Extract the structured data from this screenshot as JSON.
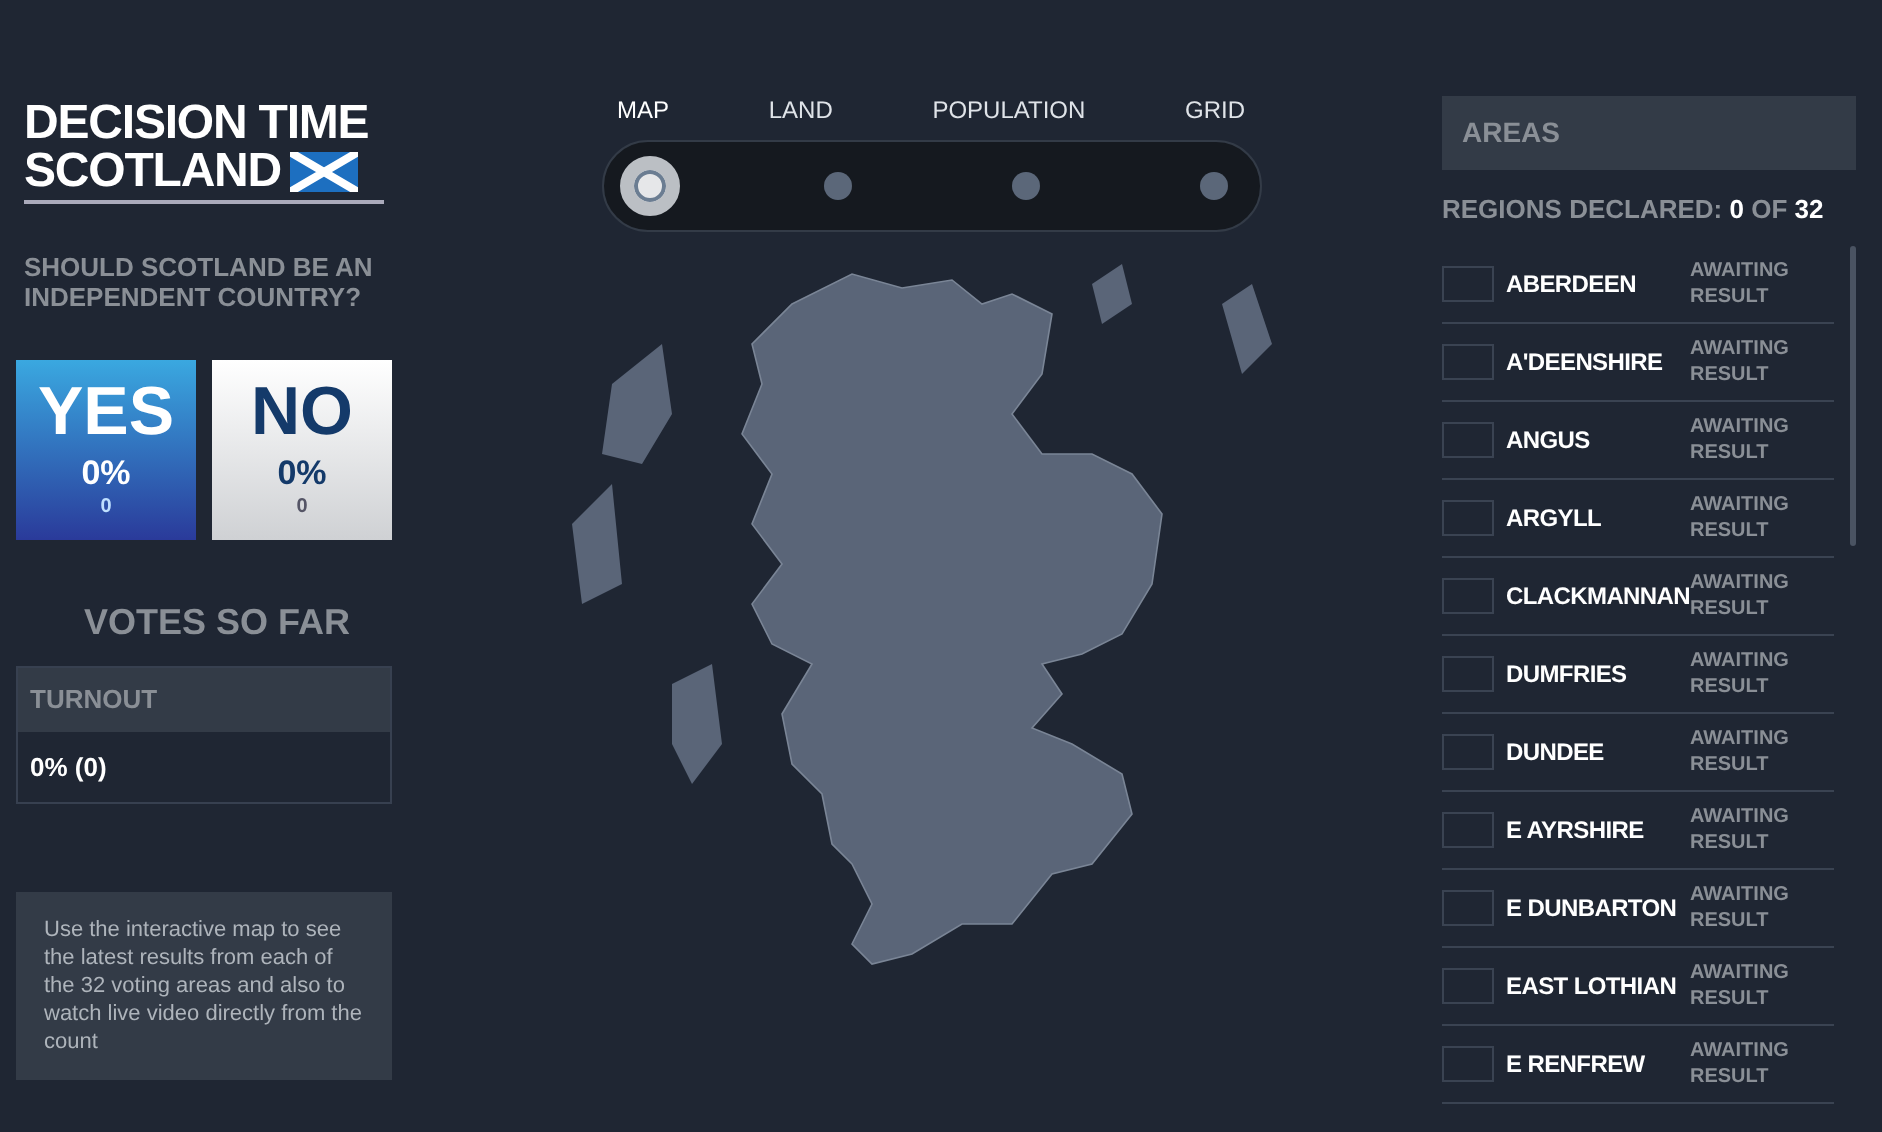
{
  "logo": {
    "line_1": "DECISION TIME",
    "line_2": "SCOTLAND"
  },
  "question": "SHOULD SCOTLAND BE AN INDEPENDENT COUNTRY?",
  "results": [
    {
      "kind": "yes",
      "label": "YES",
      "percent": "0%",
      "count": "0"
    },
    {
      "kind": "no",
      "label": "NO",
      "percent": "0%",
      "count": "0"
    }
  ],
  "votes_heading": "VOTES SO FAR",
  "turnout": {
    "label": "TURNOUT",
    "value": "0% (0)"
  },
  "info": "Use the interactive map to see the latest results from each of the 32 voting areas and also to watch live video directly from the count",
  "view_tabs": [
    {
      "label": "MAP",
      "selected": true
    },
    {
      "label": "LAND",
      "selected": false
    },
    {
      "label": "POPULATION",
      "selected": false
    },
    {
      "label": "GRID",
      "selected": false
    }
  ],
  "areas": {
    "title": "AREAS",
    "declared_label": "REGIONS DECLARED:",
    "declared": "0",
    "of": "OF",
    "total": "32",
    "items": [
      {
        "name": "ABERDEEN",
        "status": "AWAITING RESULT"
      },
      {
        "name": "A'DEENSHIRE",
        "status": "AWAITING RESULT"
      },
      {
        "name": "ANGUS",
        "status": "AWAITING RESULT"
      },
      {
        "name": "ARGYLL",
        "status": "AWAITING RESULT"
      },
      {
        "name": "CLACKMANNAN",
        "status": "AWAITING RESULT"
      },
      {
        "name": "DUMFRIES",
        "status": "AWAITING RESULT"
      },
      {
        "name": "DUNDEE",
        "status": "AWAITING RESULT"
      },
      {
        "name": "E AYRSHIRE",
        "status": "AWAITING RESULT"
      },
      {
        "name": "E DUNBARTON",
        "status": "AWAITING RESULT"
      },
      {
        "name": "EAST LOTHIAN",
        "status": "AWAITING RESULT"
      },
      {
        "name": "E RENFREW",
        "status": "AWAITING RESULT"
      }
    ]
  }
}
